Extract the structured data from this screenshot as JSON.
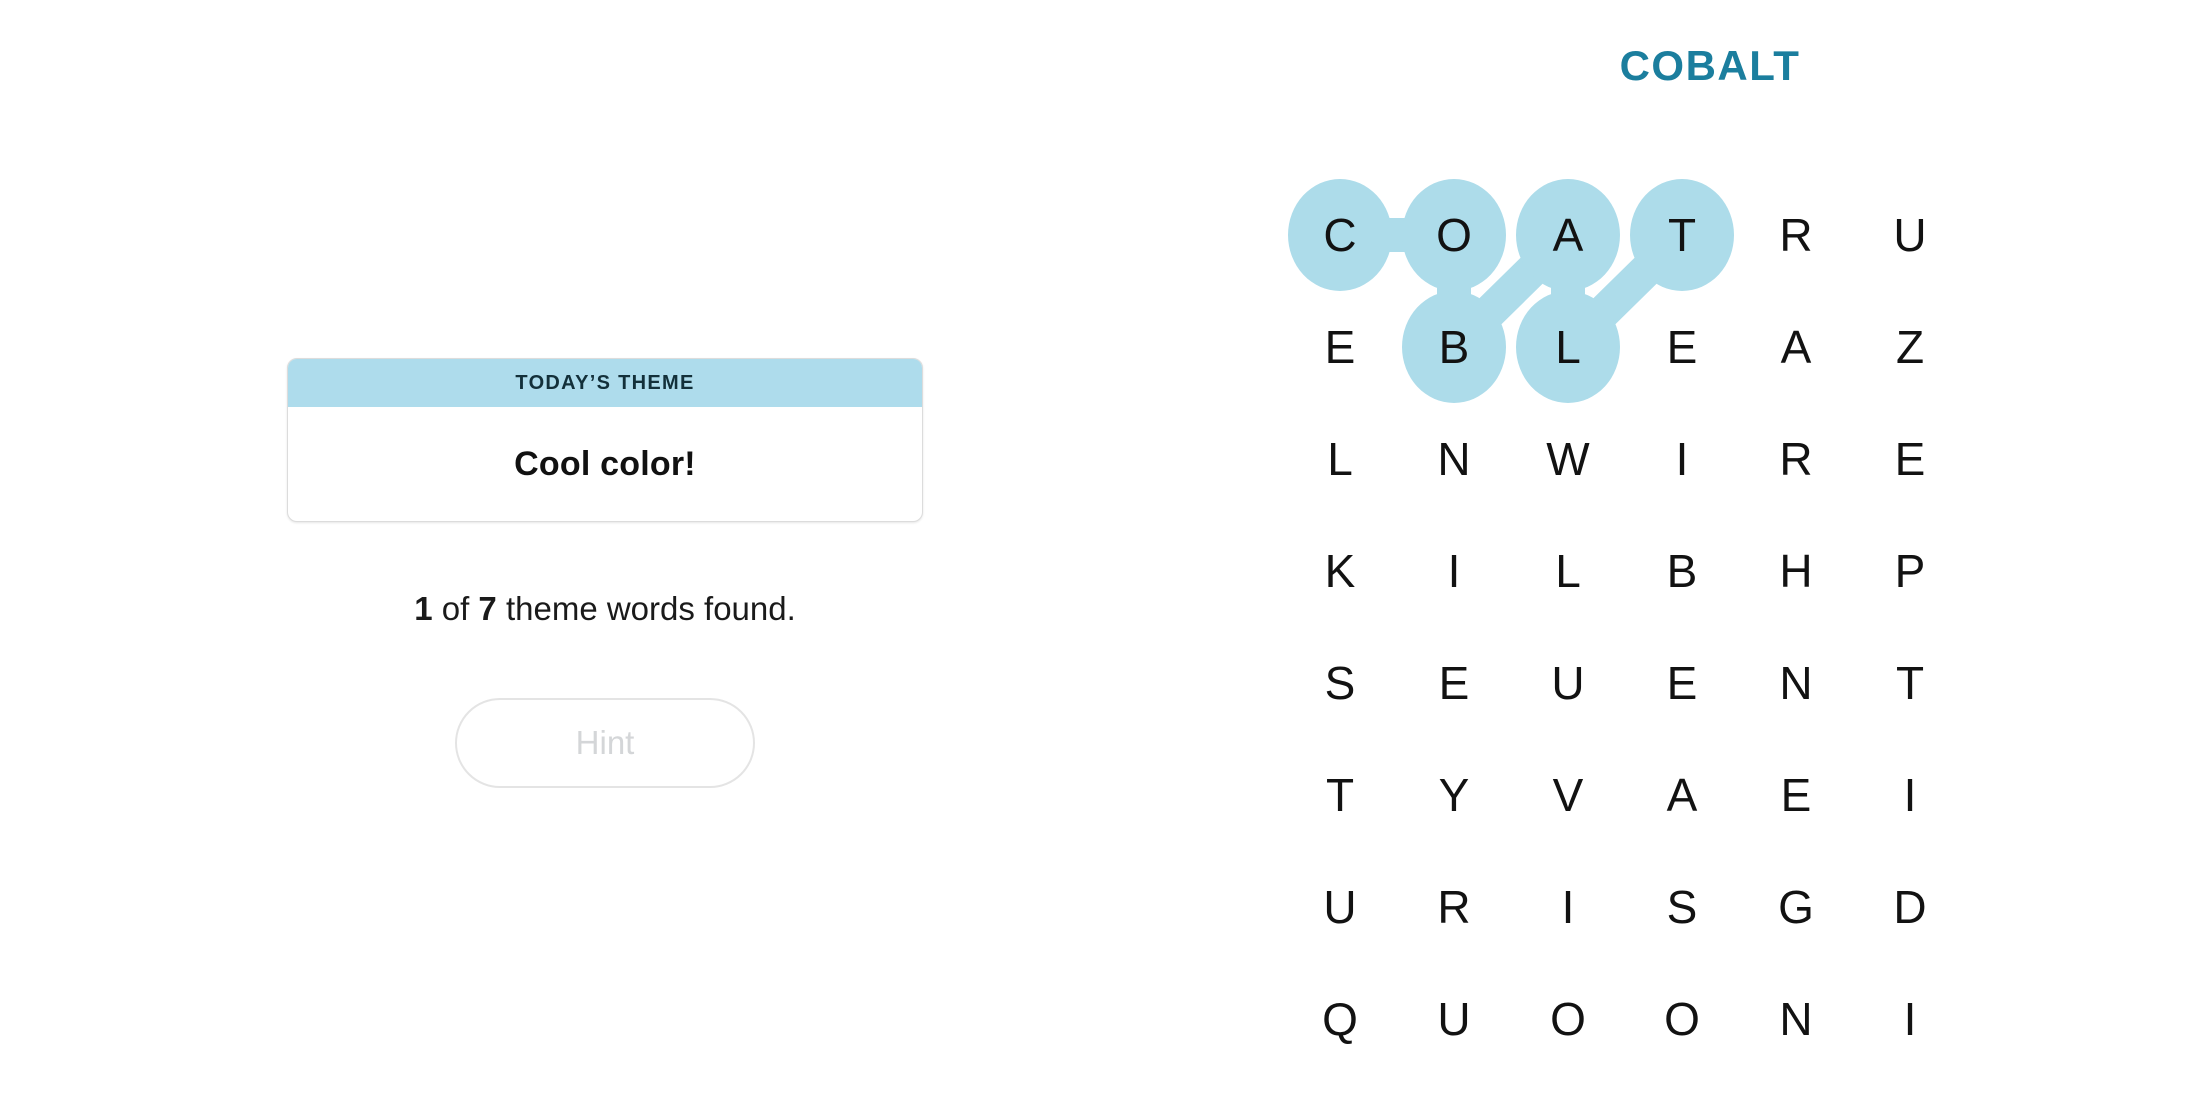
{
  "puzzle": {
    "title": "COBALT",
    "title_color": "#1b7e9e",
    "highlight_color": "#ADDCEA",
    "grid": {
      "rows": 8,
      "cols": 6,
      "letters": [
        [
          "C",
          "O",
          "A",
          "T",
          "R",
          "U"
        ],
        [
          "E",
          "B",
          "L",
          "E",
          "A",
          "Z"
        ],
        [
          "L",
          "N",
          "W",
          "I",
          "R",
          "E"
        ],
        [
          "K",
          "I",
          "L",
          "B",
          "H",
          "P"
        ],
        [
          "S",
          "E",
          "U",
          "E",
          "N",
          "T"
        ],
        [
          "T",
          "Y",
          "V",
          "A",
          "E",
          "I"
        ],
        [
          "U",
          "R",
          "I",
          "S",
          "G",
          "D"
        ],
        [
          "Q",
          "U",
          "O",
          "O",
          "N",
          "I"
        ]
      ]
    },
    "found_path": {
      "word": "COBALT",
      "cells": [
        {
          "row": 0,
          "col": 0,
          "letter": "C"
        },
        {
          "row": 0,
          "col": 1,
          "letter": "O"
        },
        {
          "row": 1,
          "col": 1,
          "letter": "B"
        },
        {
          "row": 0,
          "col": 2,
          "letter": "A"
        },
        {
          "row": 1,
          "col": 2,
          "letter": "L"
        },
        {
          "row": 0,
          "col": 3,
          "letter": "T"
        }
      ]
    }
  },
  "theme_card": {
    "header_label": "TODAY’S THEME",
    "theme": "Cool color!",
    "header_bg": "#AEDCEC"
  },
  "progress": {
    "found": "1",
    "total": "7",
    "prefix": "",
    "mid": " of ",
    "suffix": " theme words found."
  },
  "hint_button": {
    "label": "Hint",
    "enabled": false
  }
}
